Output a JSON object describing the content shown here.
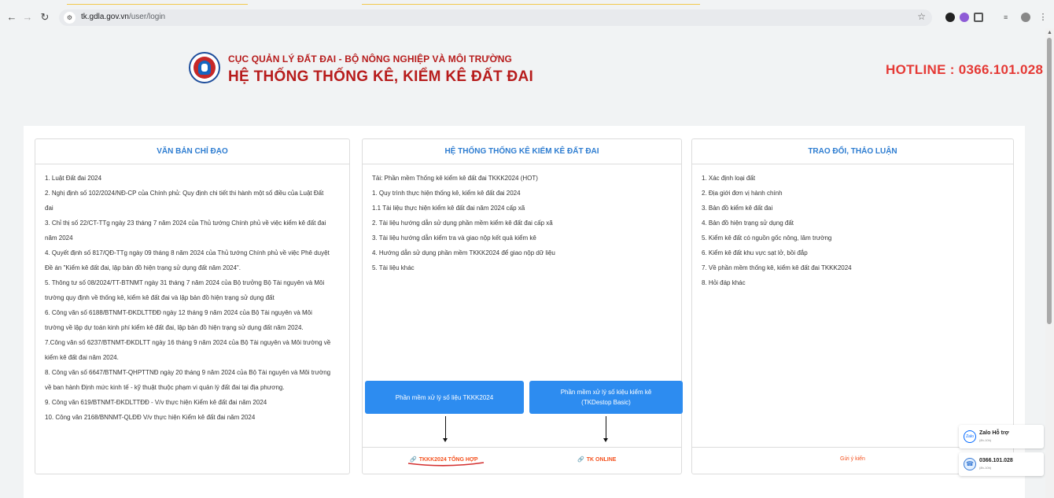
{
  "browser": {
    "url_host": "tk.gdla.gov.vn",
    "url_path": "/user/login"
  },
  "header": {
    "org": "CỤC QUẢN LÝ ĐẤT ĐAI - BỘ NÔNG NGHIỆP VÀ MÔI TRƯỜNG",
    "system": "HỆ THỐNG THỐNG KÊ, KIỂM KÊ ĐẤT ĐAI",
    "hotline": "HOTLINE : 0366.101.028"
  },
  "panels": {
    "directives": {
      "title": "VĂN BẢN CHỈ ĐẠO",
      "items": [
        "1. Luật Đất đai 2024",
        "2. Nghị định số 102/2024/NĐ-CP của Chính phủ: Quy định chi tiết thi hành một số điều của Luật Đất",
        "đai",
        "3. Chỉ thị số 22/CT-TTg ngày 23 tháng 7 năm 2024 của Thủ tướng Chính phủ về việc kiểm kê đất đai",
        "năm 2024",
        "4. Quyết định số 817/QĐ-TTg ngày 09 tháng 8 năm 2024 của Thủ tướng Chính phủ về việc Phê duyệt",
        "Đề án \"Kiểm kê đất đai, lập bản đồ hiện trạng sử dụng đất năm 2024\".",
        "5. Thông tư số 08/2024/TT-BTNMT ngày 31 tháng 7 năm 2024 của Bộ trưởng Bộ Tài nguyên và Môi",
        "trường quy định về thống kê, kiểm kê đất đai và lập bản đồ hiện trạng sử dụng đất",
        "6. Công văn số 6188/BTNMT-ĐKDLTTĐĐ ngày 12 tháng 9 năm 2024 của Bộ Tài nguyên và Môi",
        "trường về lập dự toán kinh phí kiểm kê đất đai, lập bản đồ hiện trạng sử dụng đất năm 2024.",
        "7.Công văn số 6237/BTNMT-ĐKDLTT ngày 16 tháng 9 năm 2024 của Bộ Tài nguyên và Môi trường về",
        "kiểm kê đất đai năm 2024.",
        "8. Công văn số 6647/BTNMT-QHPTTNĐ ngày 20 tháng 9 năm 2024 của Bộ Tài nguyên và Môi trường",
        "về ban hành Định mức kinh tế - kỹ thuật thuộc phạm vi quản lý đất đai tại địa phương.",
        "9. Công văn 619/BTNMT-ĐKDLTTĐĐ - V/v thực hiện Kiểm kê đất đai năm 2024",
        "10. Công văn 2168/BNNMT-QLĐĐ V/v thực hiện Kiểm kê đất đai năm 2024"
      ]
    },
    "system": {
      "title": "HỆ THỐNG THỐNG KÊ KIỂM KÊ ĐẤT ĐAI",
      "items": [
        "Tải: Phần mềm Thống kê kiểm kê đất đai TKKK2024 (HOT)",
        "1. Quy trình thực hiện thống kê, kiểm kê đất đai 2024",
        "1.1 Tài liệu thực hiện kiểm kê đất đai năm 2024 cấp xã",
        "2. Tài liệu hướng dẫn sử dụng phần mềm kiểm kê đất đai cấp xã",
        "3. Tài liệu hướng dẫn kiểm tra và giao nộp kết quả kiểm kê",
        "4. Hướng dẫn sử dụng phần mềm TKKK2024 để giao nộp dữ liệu",
        "5. Tài liệu khác"
      ],
      "button1": "Phần mềm xử lý số liệu TKKK2024",
      "button2_line1": "Phần mềm xử lý số kiệu kiểm kê",
      "button2_line2": "(TKDestop Basic)",
      "link1": "TKKK2024 TỔNG HỢP",
      "link2": "TK ONLINE"
    },
    "discussion": {
      "title": "TRAO ĐỔI, THẢO LUẬN",
      "items": [
        "1. Xác định loại đất",
        "2. Địa giới đơn vị hành chính",
        "3. Bản đồ kiểm kê đất đai",
        "4. Bản đồ hiện trạng sử dụng đất",
        "5. Kiểm kê đất có nguồn gốc nông, lâm trường",
        "6. Kiểm kê đất khu vực sạt lở, bồi đắp",
        "7. Về phần mềm thống kê, kiểm kê đất đai TKKK2024",
        "8. Hỏi đáp khác"
      ],
      "link": "Gửi ý kiến"
    }
  },
  "floating": {
    "zalo_label": "Zalo Hỗ trợ",
    "zalo_sub": "(8h-10h)",
    "phone_label": "0366.101.028",
    "phone_sub": "(8h-10h)"
  },
  "colors": {
    "brand_red": "#b71c1c",
    "hotline_red": "#e53935",
    "title_blue": "#2e7dd1",
    "button_blue": "#2d8cf0",
    "link_orange": "#f4511e"
  }
}
